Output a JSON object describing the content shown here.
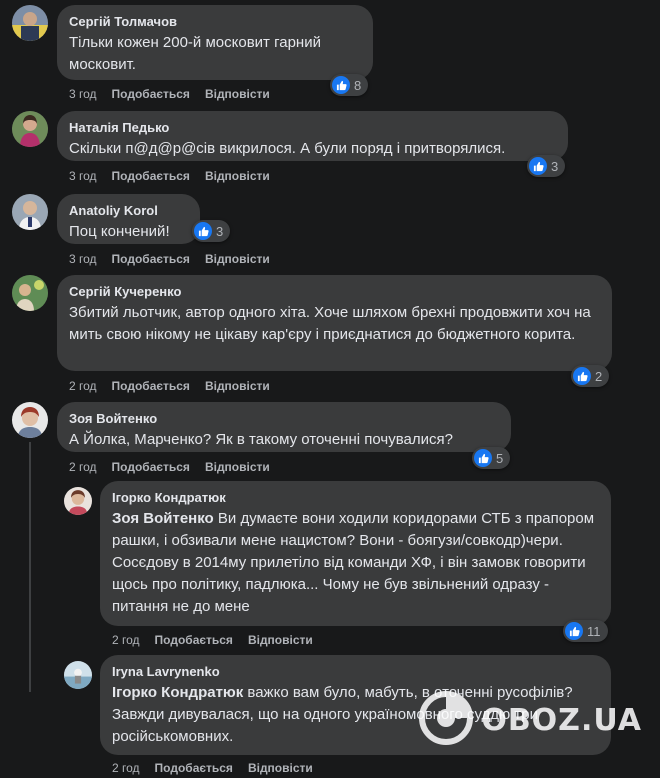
{
  "comments": [
    {
      "author": "Сергій Толмачов",
      "text": "Тільки кожен 200-й московит гарний московит.",
      "time": "3 год",
      "like": "Подобається",
      "reply": "Відповісти",
      "reactions": "8"
    },
    {
      "author": "Наталія Педько",
      "text": "Скільки п@д@р@сів викрилося. А були поряд і притворялися.",
      "time": "3 год",
      "like": "Подобається",
      "reply": "Відповісти",
      "reactions": "3"
    },
    {
      "author": "Anatoliy Korol",
      "text": "Поц кончений!",
      "time": "3 год",
      "like": "Подобається",
      "reply": "Відповісти",
      "reactions": "3"
    },
    {
      "author": "Сергій Кучеренко",
      "text": "Збитий льотчик, автор одного хіта. Хоче шляхом брехні продовжити хоч на мить свою нікому не цікаву кар'єру і приєднатися до бюджетного корита.",
      "time": "2 год",
      "like": "Подобається",
      "reply": "Відповісти",
      "reactions": "2"
    },
    {
      "author": "Зоя Войтенко",
      "text": "А Йолка, Марченко? Як в такому оточенні почувалися?",
      "time": "2 год",
      "like": "Подобається",
      "reply": "Відповісти",
      "reactions": "5"
    }
  ],
  "replies": [
    {
      "author": "Ігорко Кондратюк",
      "mention": "Зоя Войтенко",
      "text": " Ви думаєте вони ходили коридорами СТБ з прапором рашки, і обзивали мене нацистом? Вони - боягузи/совкодр)чери. Сосєдову в 2014му прилетіло від команди ХФ, і він замовк говорити щось про політику, падлюка... Чому не був звільнений одразу - питання не до мене",
      "time": "2 год",
      "like": "Подобається",
      "reply": "Відповісти",
      "reactions": "11"
    },
    {
      "author": "Iryna Lavrynenko",
      "mention": "Ігорко Кондратюк",
      "text": " важко вам було, мабуть, в оточенні русофілів? Завжди дивувалася, що на одного україномовного суддю три російськомовних.",
      "time": "2 год",
      "like": "Подобається",
      "reply": "Відповісти",
      "reactions": ""
    }
  ],
  "watermark": "OBOZ.UA",
  "icons": {
    "like": "thumbs-up-icon",
    "watermark_logo": "oboz-logo-icon"
  },
  "colors": {
    "background": "#18191a",
    "bubble": "#3a3b3c",
    "like_blue": "#1877f2",
    "muted": "#b0b3b8"
  }
}
